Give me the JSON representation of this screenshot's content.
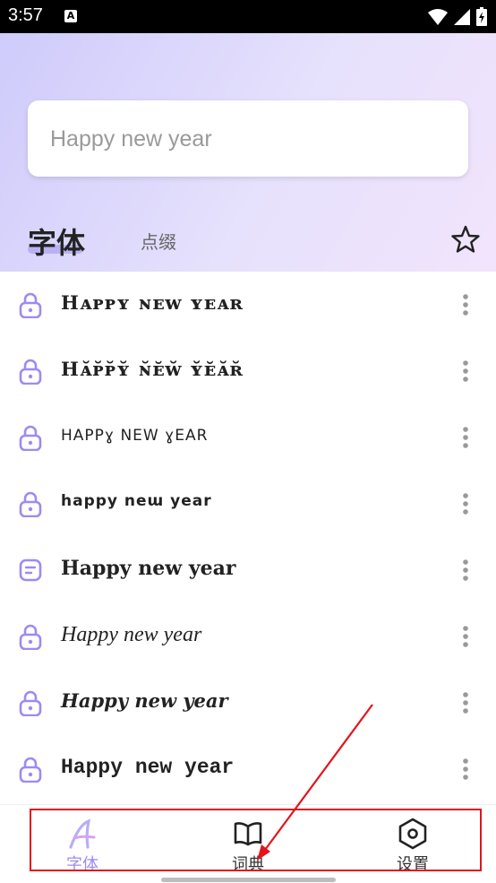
{
  "status_bar": {
    "time": "3:57",
    "notif_icon": "A"
  },
  "search": {
    "value": "Happy new year"
  },
  "tabs": {
    "font": "字体",
    "decoration": "点缀"
  },
  "font_list": [
    {
      "text": "Hᴀᴘᴘʏ ɴᴇᴡ ʏᴇᴀʀ",
      "icon": "lock-icon"
    },
    {
      "text": "Hᴀ̆ᴘ̆ᴘ̆ʏ̆ ɴ̆ᴇ̆ᴡ̆ ʏ̆ᴇ̆ᴀ̆ʀ̆",
      "icon": "lock-icon"
    },
    {
      "text": "HAPPɣ NEW ɣEAR",
      "icon": "lock-icon"
    },
    {
      "text": "happy neɯ year",
      "icon": "lock-icon"
    },
    {
      "text": "Happy new year",
      "icon": "note-icon"
    },
    {
      "text": "Happy new year",
      "icon": "lock-icon"
    },
    {
      "text": "Happy new year",
      "icon": "lock-icon"
    },
    {
      "text": "Happy new year",
      "icon": "lock-icon"
    }
  ],
  "bottom_nav": [
    {
      "label": "字体",
      "icon": "font-icon",
      "active": true
    },
    {
      "label": "词典",
      "icon": "book-icon",
      "active": false
    },
    {
      "label": "设置",
      "icon": "settings-icon",
      "active": false
    }
  ],
  "colors": {
    "accent": "#9b8cf0",
    "annotation": "#e2141c"
  }
}
